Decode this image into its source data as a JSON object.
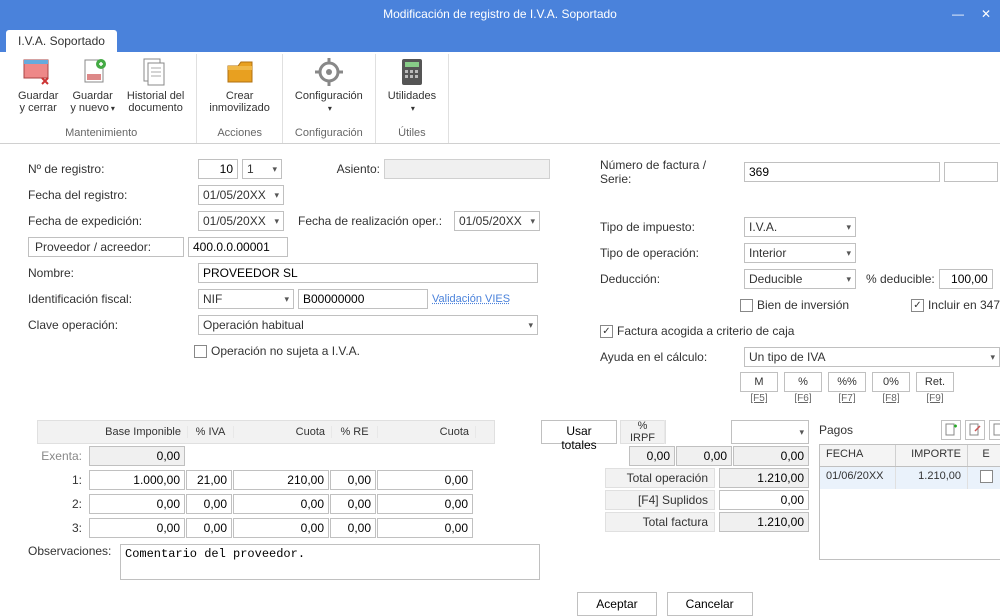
{
  "window": {
    "title": "Modificación de registro de I.V.A. Soportado"
  },
  "tabs": {
    "main": "I.V.A. Soportado"
  },
  "ribbon": {
    "groups": {
      "mantenimiento": {
        "title": "Mantenimiento",
        "guardar_cerrar": "Guardar\ny cerrar",
        "guardar_nuevo": "Guardar\ny nuevo",
        "historial": "Historial del\ndocumento"
      },
      "acciones": {
        "title": "Acciones",
        "crear_inmovilizado": "Crear\ninmovilizado"
      },
      "configuracion": {
        "title": "Configuración",
        "configuracion": "Configuración"
      },
      "utiles": {
        "title": "Útiles",
        "utilidades": "Utilidades"
      }
    }
  },
  "labels": {
    "n_registro": "Nº de registro:",
    "asiento": "Asiento:",
    "fecha_registro": "Fecha del registro:",
    "fecha_expedicion": "Fecha de expedición:",
    "fecha_realizacion": "Fecha de realización oper.:",
    "proveedor": "Proveedor / acreedor:",
    "nombre": "Nombre:",
    "ident_fiscal": "Identificación fiscal:",
    "validacion_vies": "Validación VIES",
    "clave_operacion": "Clave operación:",
    "op_no_sujeta": "Operación no sujeta a I.V.A.",
    "num_factura": "Número de factura / Serie:",
    "tipo_impuesto": "Tipo de impuesto:",
    "tipo_operacion": "Tipo de operación:",
    "deduccion": "Deducción:",
    "pct_deducible": "% deducible:",
    "bien_inversion": "Bien de inversión",
    "incluir_347": "Incluir en 347",
    "factura_criterio_caja": "Factura acogida a criterio de caja",
    "ayuda_calculo": "Ayuda en el cálculo:",
    "usar_totales": "Usar totales",
    "pagos": "Pagos",
    "observaciones": "Observaciones:"
  },
  "values": {
    "n_registro": "10",
    "n_registro_serie": "1",
    "asiento": "",
    "fecha_registro": "01/05/20XX",
    "fecha_expedicion": "01/05/20XX",
    "fecha_realizacion": "01/05/20XX",
    "proveedor": "400.0.0.00001",
    "nombre": "PROVEEDOR SL",
    "ident_tipo": "NIF",
    "ident_num": "B00000000",
    "clave_operacion": "Operación habitual",
    "num_factura": "369",
    "serie": "",
    "tipo_impuesto": "I.V.A.",
    "tipo_operacion": "Interior",
    "deduccion": "Deducible",
    "pct_deducible": "100,00",
    "ayuda_calculo": "Un tipo de IVA",
    "obs": "Comentario del proveedor."
  },
  "calc": {
    "btn_m": "M",
    "btn_pct": "%",
    "btn_pctpct": "%%",
    "btn_0pct": "0%",
    "btn_ret": "Ret.",
    "f5": "[F5]",
    "f6": "[F6]",
    "f7": "[F7]",
    "f8": "[F8]",
    "f9": "[F9]"
  },
  "grid": {
    "headers": {
      "base": "Base Imponible",
      "pct_iva": "% IVA",
      "cuota": "Cuota",
      "pct_re": "% RE",
      "cuota2": "Cuota",
      "pct_irpf": "% IRPF"
    },
    "labels": {
      "exenta": "Exenta:",
      "r1": "1:",
      "r2": "2:",
      "r3": "3:"
    },
    "rows": {
      "exenta": {
        "base": "0,00"
      },
      "r1": {
        "base": "1.000,00",
        "pct_iva": "21,00",
        "cuota": "210,00",
        "pct_re": "0,00",
        "cuota2": "0,00"
      },
      "r2": {
        "base": "0,00",
        "pct_iva": "0,00",
        "cuota": "0,00",
        "pct_re": "0,00",
        "cuota2": "0,00"
      },
      "r3": {
        "base": "0,00",
        "pct_iva": "0,00",
        "cuota": "0,00",
        "pct_re": "0,00",
        "cuota2": "0,00"
      }
    },
    "irpf": {
      "pct": "0,00",
      "base": "0,00",
      "cuota": "0,00"
    }
  },
  "totals": {
    "total_operacion_lbl": "Total operación",
    "total_operacion": "1.210,00",
    "suplidos_lbl": "[F4] Suplidos",
    "suplidos": "0,00",
    "total_factura_lbl": "Total factura",
    "total_factura": "1.210,00"
  },
  "pagos": {
    "hdr_fecha": "FECHA",
    "hdr_importe": "IMPORTE",
    "hdr_e": "E",
    "rows": [
      {
        "fecha": "01/06/20XX",
        "importe": "1.210,00"
      }
    ]
  },
  "buttons": {
    "aceptar": "Aceptar",
    "cancelar": "Cancelar"
  }
}
